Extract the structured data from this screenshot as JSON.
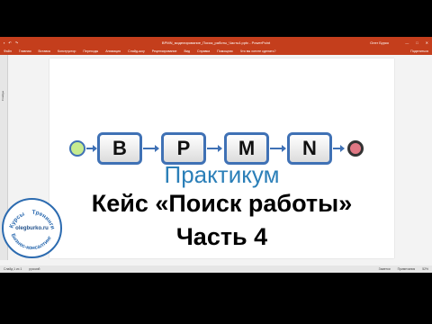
{
  "window": {
    "title": "BPMN_моделирование_Поиск_работы_Часть4.pptx - PowerPoint",
    "user": "Олег Бурко",
    "controls": [
      "—",
      "□",
      "✕"
    ]
  },
  "ribbon": {
    "tabs": [
      "Файл",
      "Главная",
      "Вставка",
      "Конструктор",
      "Переходы",
      "Анимация",
      "Слайд-шоу",
      "Рецензирование",
      "Вид",
      "Справка",
      "Помощник",
      "Что вы хотите сделать?"
    ],
    "share": "Поделиться"
  },
  "rail": {
    "label": "Слайды"
  },
  "slide": {
    "bpmn_letters": [
      "B",
      "P",
      "M",
      "N"
    ],
    "subtitle": "Практикум",
    "title": "Кейс «Поиск работы»",
    "part": "Часть 4",
    "colors": {
      "accent": "#3f71b5",
      "start": "#c7eb8f",
      "end": "#e07884",
      "subtitle": "#2b7fb8",
      "app": "#c43e1c"
    }
  },
  "statusbar": {
    "left": [
      "Слайд 1 из 1",
      "русский"
    ],
    "right": [
      "Заметки",
      "Примечания",
      "52%"
    ]
  },
  "logo": {
    "top_left": "Курсы",
    "top_right": "Тренинги",
    "center": "olegburko.ru",
    "bottom": "Бизнес-консалтинг"
  }
}
